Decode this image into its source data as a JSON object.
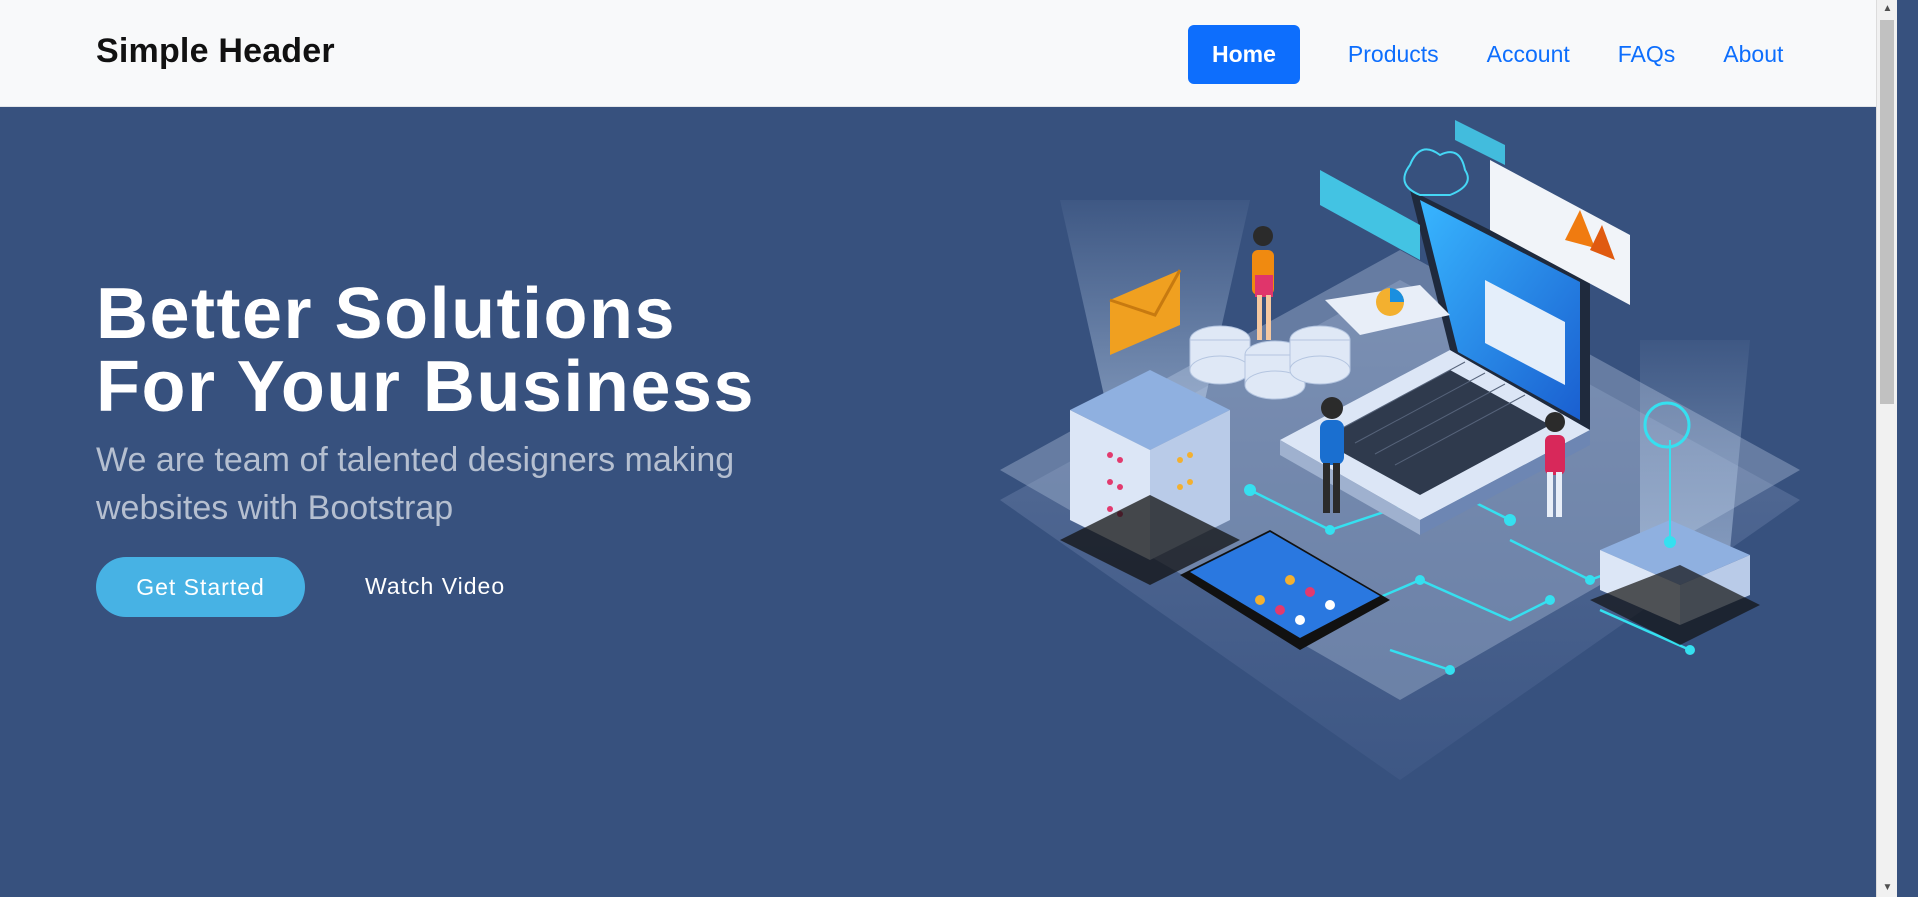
{
  "header": {
    "brand": "Simple Header",
    "nav": [
      {
        "label": "Home",
        "active": true
      },
      {
        "label": "Products",
        "active": false
      },
      {
        "label": "Account",
        "active": false
      },
      {
        "label": "FAQs",
        "active": false
      },
      {
        "label": "About",
        "active": false
      }
    ]
  },
  "hero": {
    "title_line1": "Better Solutions",
    "title_line2": "For Your Business",
    "subtitle": "We are team of talented designers making websites with Bootstrap",
    "cta_primary": "Get Started",
    "cta_secondary": "Watch Video",
    "illustration_icon": "isometric-tech-illustration"
  },
  "colors": {
    "hero_bg": "#37517e",
    "header_bg": "#f8f9fa",
    "nav_link": "#0d6efd",
    "cta_bg": "#47b2e4"
  }
}
